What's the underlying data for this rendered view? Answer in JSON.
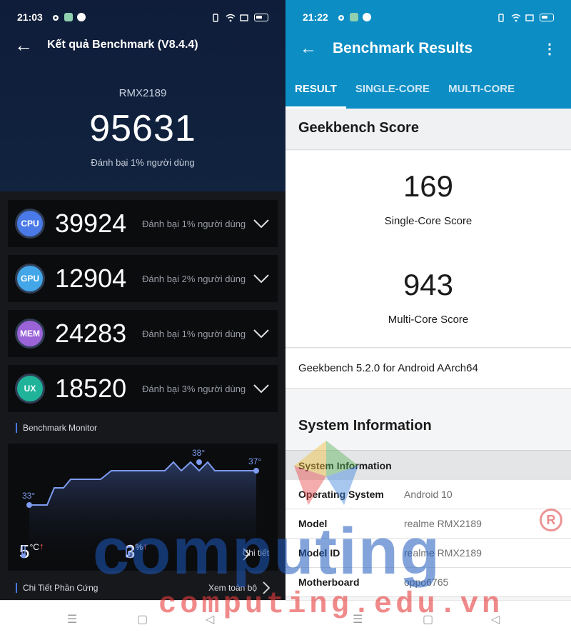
{
  "left": {
    "status": {
      "time": "21:03"
    },
    "header": {
      "back": "←",
      "title": "Kết quả Benchmark (V8.4.4)"
    },
    "device": "RMX2189",
    "total_score": "95631",
    "total_beat": "Đánh bại 1% người dùng",
    "scores": [
      {
        "badge": "CPU",
        "value": "39924",
        "beat": "Đánh bại 1% người dùng"
      },
      {
        "badge": "GPU",
        "value": "12904",
        "beat": "Đánh bại 2% người dùng"
      },
      {
        "badge": "MEM",
        "value": "24283",
        "beat": "Đánh bại 1% người dùng"
      },
      {
        "badge": "UX",
        "value": "18520",
        "beat": "Đánh bại 3% người dùng"
      }
    ],
    "monitor": {
      "label": "Benchmark Monitor",
      "temp_start": "33°",
      "temp_peak": "38°",
      "temp_end": "37°",
      "temp_delta": "5",
      "temp_unit": "°C",
      "battery_delta": "3",
      "battery_unit": "%",
      "detail": "Chi tiết"
    },
    "hardware": {
      "label": "Chi Tiết Phần Cứng",
      "view_all": "Xem toàn bộ"
    }
  },
  "right": {
    "status": {
      "time": "21:22"
    },
    "header": {
      "back": "←",
      "title": "Benchmark Results",
      "more": "⋮"
    },
    "tabs": [
      "RESULT",
      "SINGLE-CORE",
      "MULTI-CORE"
    ],
    "geekbench_title": "Geekbench Score",
    "single_core": {
      "value": "169",
      "label": "Single-Core Score"
    },
    "multi_core": {
      "value": "943",
      "label": "Multi-Core Score"
    },
    "version": "Geekbench 5.2.0 for Android AArch64",
    "system_title": "System Information",
    "system_sub": "System Information",
    "system_rows": [
      {
        "key": "Operating System",
        "value": "Android 10"
      },
      {
        "key": "Model",
        "value": "realme RMX2189"
      },
      {
        "key": "Model ID",
        "value": "realme RMX2189"
      },
      {
        "key": "Motherboard",
        "value": "oppo6765"
      }
    ]
  },
  "navbar": {
    "menu": "☰",
    "home": "▢",
    "back": "◁"
  },
  "watermark": {
    "main": "computing",
    "sub": "computing.edu.vn",
    "reg": "R"
  },
  "colors": {
    "antutu_bg": "#17181c",
    "geekbench_blue": "#0c8dc4",
    "chart_line": "#7e9cf0"
  }
}
